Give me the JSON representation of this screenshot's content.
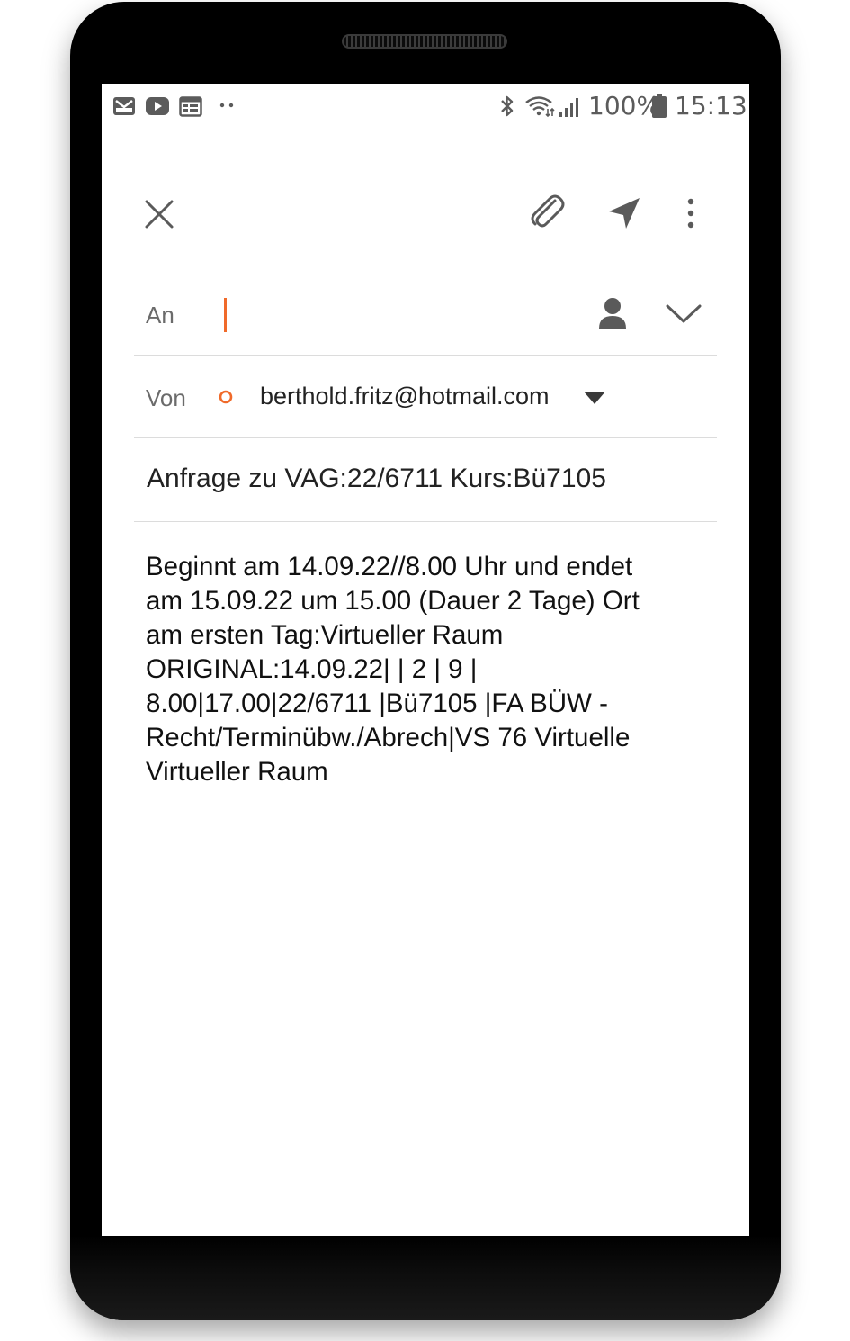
{
  "status_bar": {
    "left_icons": [
      "mail-icon",
      "youtube-icon",
      "calendar-icon",
      "more-notifications-icon"
    ],
    "right_icons": [
      "bluetooth-icon",
      "wifi-icon",
      "signal-icon",
      "battery-icon"
    ],
    "battery_percent": "100%",
    "time": "15:13"
  },
  "toolbar": {
    "close_icon": "close-icon",
    "attach_icon": "paperclip-icon",
    "send_icon": "send-icon",
    "more_icon": "more-vertical-icon"
  },
  "compose": {
    "to_label": "An",
    "from_label": "Von",
    "from_email": "berthold.fritz@hotmail.com",
    "subject": "Anfrage zu VAG:22/6711 Kurs:Bü7105",
    "body": "Beginnt am 14.09.22//8.00 Uhr und endet\nam 15.09.22 um 15.00 (Dauer 2 Tage) Ort\nam ersten Tag:Virtueller Raum\nORIGINAL:14.09.22| | 2 | 9 |\n8.00|17.00|22/6711 |Bü7105 |FA BÜW -\nRecht/Terminübw./Abrech|VS 76 Virtuelle\nVirtueller Raum"
  },
  "colors": {
    "accent": "#f06a2a",
    "icon_gray": "#5a5a5a",
    "divider": "#dcdcdc"
  }
}
